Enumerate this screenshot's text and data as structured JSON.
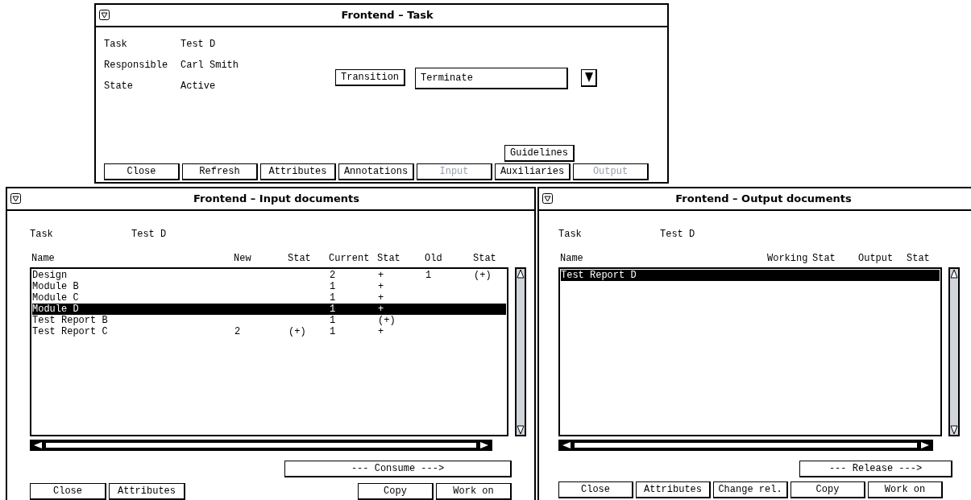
{
  "task_window": {
    "title": "Frontend – Task",
    "fields": [
      {
        "label": "Task",
        "value": "Test D"
      },
      {
        "label": "Responsible",
        "value": "Carl Smith"
      },
      {
        "label": "State",
        "value": "Active"
      }
    ],
    "transition_button": "Transition",
    "transition_value": "Terminate",
    "guidelines_button": "Guidelines",
    "buttons": [
      {
        "label": "Close",
        "disabled": false
      },
      {
        "label": "Refresh",
        "disabled": false
      },
      {
        "label": "Attributes",
        "disabled": false
      },
      {
        "label": "Annotations",
        "disabled": false
      },
      {
        "label": "Input",
        "disabled": true
      },
      {
        "label": "Auxiliaries",
        "disabled": false
      },
      {
        "label": "Output",
        "disabled": true
      }
    ]
  },
  "input_window": {
    "title": "Frontend – Input documents",
    "task_label": "Task",
    "task_value": "Test D",
    "columns": [
      "Name",
      "New",
      "Stat",
      "Current",
      "Stat",
      "Old",
      "Stat"
    ],
    "rows": [
      {
        "cells": [
          "Design",
          "",
          "",
          "2",
          "+",
          "1",
          "(+)"
        ],
        "selected": false
      },
      {
        "cells": [
          "Module B",
          "",
          "",
          "1",
          "+",
          "",
          ""
        ],
        "selected": false
      },
      {
        "cells": [
          "Module C",
          "",
          "",
          "1",
          "+",
          "",
          ""
        ],
        "selected": false
      },
      {
        "cells": [
          "Module D",
          "",
          "",
          "1",
          "+",
          "",
          ""
        ],
        "selected": true
      },
      {
        "cells": [
          "Test Report B",
          "",
          "",
          "1",
          "(+)",
          "",
          ""
        ],
        "selected": false
      },
      {
        "cells": [
          "Test Report C",
          "2",
          "(+)",
          "1",
          "+",
          "",
          ""
        ],
        "selected": false
      }
    ],
    "action_button": "--- Consume --->",
    "left_buttons": [
      "Close",
      "Attributes"
    ],
    "right_buttons": [
      "Copy",
      "Work on"
    ]
  },
  "output_window": {
    "title": "Frontend – Output documents",
    "task_label": "Task",
    "task_value": "Test D",
    "columns": [
      "Name",
      "Working",
      "Stat",
      "Output",
      "Stat"
    ],
    "rows": [
      {
        "cells": [
          "Test Report D",
          "",
          "",
          "",
          ""
        ],
        "selected": true
      }
    ],
    "action_button": "--- Release --->",
    "buttons": [
      "Close",
      "Attributes",
      "Change rel.",
      "Copy",
      "Work on"
    ]
  }
}
